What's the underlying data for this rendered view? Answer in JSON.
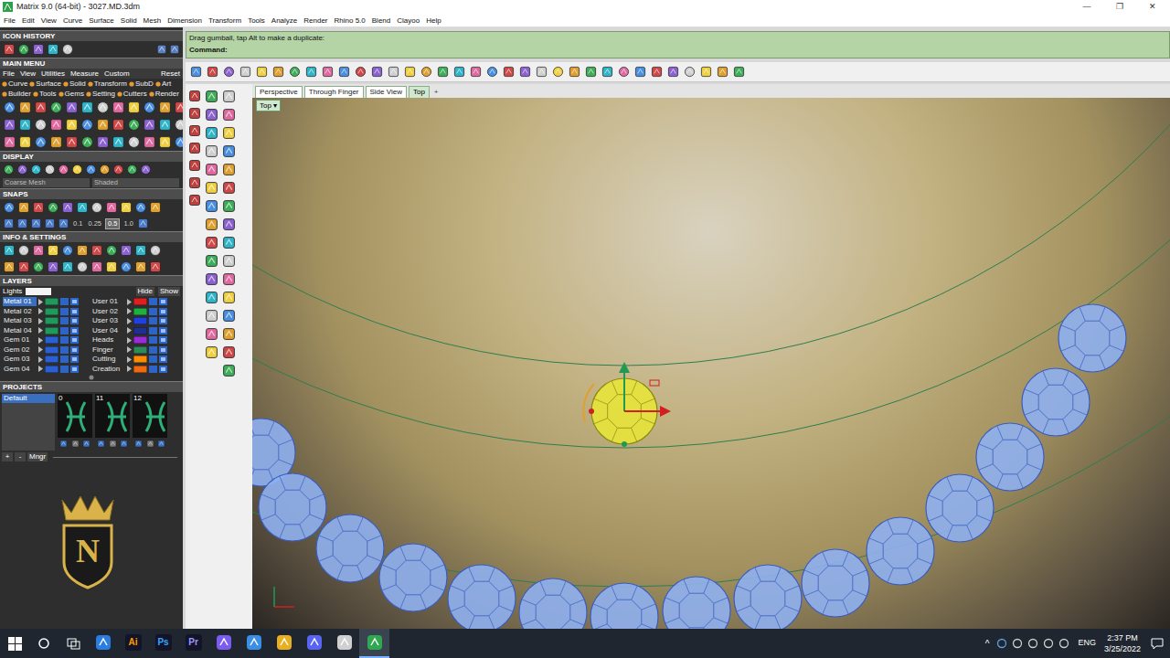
{
  "window": {
    "title": "Matrix 9.0 (64-bit) - 3027.MD.3dm",
    "controls": [
      "—",
      "❐",
      "✕"
    ]
  },
  "menu": [
    "File",
    "Edit",
    "View",
    "Curve",
    "Surface",
    "Solid",
    "Mesh",
    "Dimension",
    "Transform",
    "Tools",
    "Analyze",
    "Render",
    "Rhino 5.0",
    "Blend",
    "Clayoo",
    "Help"
  ],
  "sidebar": {
    "icon_history": {
      "title": "ICON HISTORY"
    },
    "main_menu": {
      "title": "MAIN MENU",
      "tabs": [
        "File",
        "View",
        "Utilities",
        "Measure",
        "Custom"
      ],
      "reset": "Reset",
      "categories": [
        [
          "Curve",
          "Surface",
          "Solid",
          "Transform",
          "SubD",
          "Art"
        ],
        [
          "Builder",
          "Tools",
          "Gems",
          "Setting",
          "Cutters",
          "Render"
        ]
      ]
    },
    "display": {
      "title": "DISPLAY",
      "mesh": "Coarse Mesh",
      "mode": "Shaded"
    },
    "snaps": {
      "title": "SNAPS",
      "values": [
        {
          "label": "0.1",
          "selected": false
        },
        {
          "label": "0.25",
          "selected": false
        },
        {
          "label": "0.5",
          "selected": true
        },
        {
          "label": "1.0",
          "selected": false
        }
      ]
    },
    "info": {
      "title": "INFO & SETTINGS"
    },
    "layers": {
      "title": "LAYERS",
      "lights": "Lights",
      "hide": "Hide",
      "show": "Show",
      "left": [
        {
          "name": "Metal 01",
          "selected": true,
          "color": "#1f9a5c"
        },
        {
          "name": "Metal 02",
          "selected": false,
          "color": "#1f9a5c"
        },
        {
          "name": "Metal 03",
          "selected": false,
          "color": "#1f9a5c"
        },
        {
          "name": "Metal 04",
          "selected": false,
          "color": "#1f9a5c"
        },
        {
          "name": "Gem 01",
          "selected": false,
          "color": "#2b5fd6"
        },
        {
          "name": "Gem 02",
          "selected": false,
          "color": "#2b5fd6"
        },
        {
          "name": "Gem 03",
          "selected": false,
          "color": "#2b5fd6"
        },
        {
          "name": "Gem 04",
          "selected": false,
          "color": "#2b5fd6"
        }
      ],
      "right": [
        {
          "name": "User 01",
          "selected": false,
          "color": "#e02020"
        },
        {
          "name": "User 02",
          "selected": false,
          "color": "#20b040"
        },
        {
          "name": "User 03",
          "selected": false,
          "color": "#2040e0"
        },
        {
          "name": "User 04",
          "selected": false,
          "color": "#203090"
        },
        {
          "name": "Heads",
          "selected": false,
          "color": "#9a2bd6"
        },
        {
          "name": "Finger",
          "selected": false,
          "color": "#2e8b57"
        },
        {
          "name": "Cutting",
          "selected": false,
          "color": "#ff8c00"
        },
        {
          "name": "Creation",
          "selected": false,
          "color": "#f06a10"
        }
      ]
    },
    "projects": {
      "title": "PROJECTS",
      "items": [
        {
          "label": "Default",
          "selected": true
        }
      ],
      "thumbnails": [
        "0",
        "11",
        "12"
      ],
      "buttons": [
        "+",
        "-"
      ],
      "manager": "Mngr"
    },
    "logo": {
      "monogram": "N"
    }
  },
  "command": {
    "history": "Drag gumball, tap Alt to make a duplicate:",
    "prompt": "Command:"
  },
  "viewport": {
    "tabs": [
      {
        "label": "Perspective",
        "selected": false
      },
      {
        "label": "Through Finger",
        "selected": false
      },
      {
        "label": "Side View",
        "selected": false
      },
      {
        "label": "Top",
        "selected": true
      }
    ],
    "add": "+",
    "label": "Top",
    "menu_arrow": "▾"
  },
  "taskbar": {
    "apps": [
      {
        "kind": "glyph",
        "color": "#2a7de1",
        "selected": false
      },
      {
        "kind": "badge",
        "label": "Ai",
        "color": "#ff9a00",
        "selected": false
      },
      {
        "kind": "badge",
        "label": "Ps",
        "color": "#31a8ff",
        "selected": false
      },
      {
        "kind": "badge",
        "label": "Pr",
        "color": "#9999ff",
        "selected": false
      },
      {
        "kind": "glyph",
        "color": "#7a5cf0",
        "selected": false
      },
      {
        "kind": "glyph",
        "color": "#3a8ee6",
        "selected": false
      },
      {
        "kind": "glyph",
        "color": "#e8b020",
        "selected": false
      },
      {
        "kind": "glyph",
        "color": "#5865f2",
        "selected": false
      },
      {
        "kind": "glyph",
        "color": "#d0d0d0",
        "selected": false
      },
      {
        "kind": "glyph",
        "color": "#2fa84f",
        "selected": true
      }
    ],
    "tray": "^",
    "lang": "ENG",
    "time": "2:37 PM",
    "date": "3/25/2022"
  }
}
